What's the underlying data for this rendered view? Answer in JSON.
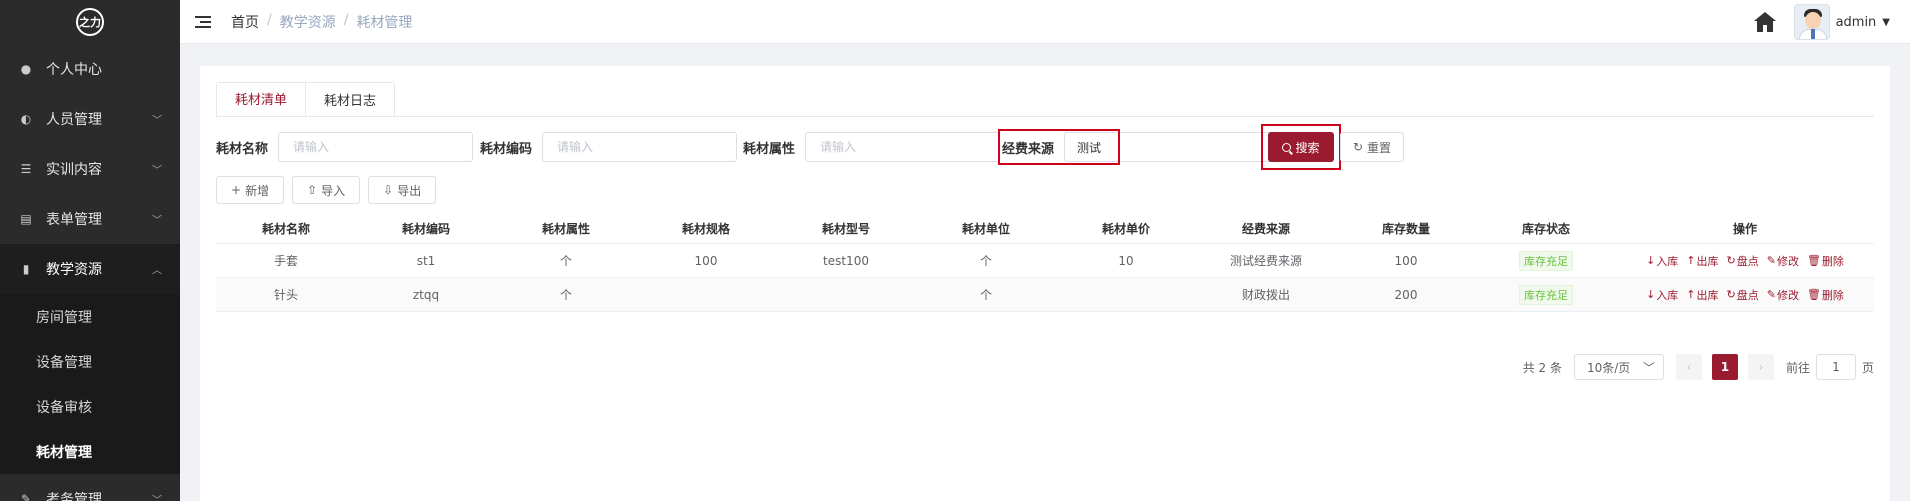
{
  "logo": {
    "text": "之力"
  },
  "sidebar": {
    "items": [
      {
        "label": "个人中心",
        "icon": "user-icon"
      },
      {
        "label": "人员管理",
        "icon": "users-icon"
      },
      {
        "label": "实训内容",
        "icon": "list-icon"
      },
      {
        "label": "表单管理",
        "icon": "form-icon"
      },
      {
        "label": "教学资源",
        "icon": "info-icon"
      }
    ],
    "submenu": [
      "房间管理",
      "设备管理",
      "设备审核",
      "耗材管理"
    ],
    "last_item": {
      "label": "考务管理",
      "icon": "edit-icon"
    }
  },
  "header": {
    "breadcrumb": [
      "首页",
      "教学资源",
      "耗材管理"
    ],
    "username": "admin"
  },
  "tabs": [
    "耗材清单",
    "耗材日志"
  ],
  "filters": {
    "name_label": "耗材名称",
    "name_placeholder": "请输入",
    "code_label": "耗材编码",
    "code_placeholder": "请输入",
    "attr_label": "耗材属性",
    "attr_placeholder": "请输入",
    "source_label": "经费来源",
    "source_value": "测试",
    "search_label": "搜索",
    "reset_label": "重置"
  },
  "toolbar": {
    "add_label": "新增",
    "import_label": "导入",
    "export_label": "导出"
  },
  "table": {
    "headers": [
      "耗材名称",
      "耗材编码",
      "耗材属性",
      "耗材规格",
      "耗材型号",
      "耗材单位",
      "耗材单价",
      "经费来源",
      "库存数量",
      "库存状态",
      "操作"
    ],
    "rows": [
      [
        "手套",
        "st1",
        "个",
        "100",
        "test100",
        "个",
        "10",
        "测试经费来源",
        "100",
        "库存充足"
      ],
      [
        "针头",
        "ztqq",
        "个",
        "",
        "",
        "个",
        "",
        "财政拨出",
        "200",
        "库存充足"
      ]
    ],
    "ops": [
      "入库",
      "出库",
      "盘点",
      "修改",
      "删除"
    ]
  },
  "pagination": {
    "total_text": "共 2 条",
    "page_size": "10条/页",
    "current_page": "1",
    "goto_label": "前往",
    "goto_value": "1",
    "page_suffix": "页"
  }
}
